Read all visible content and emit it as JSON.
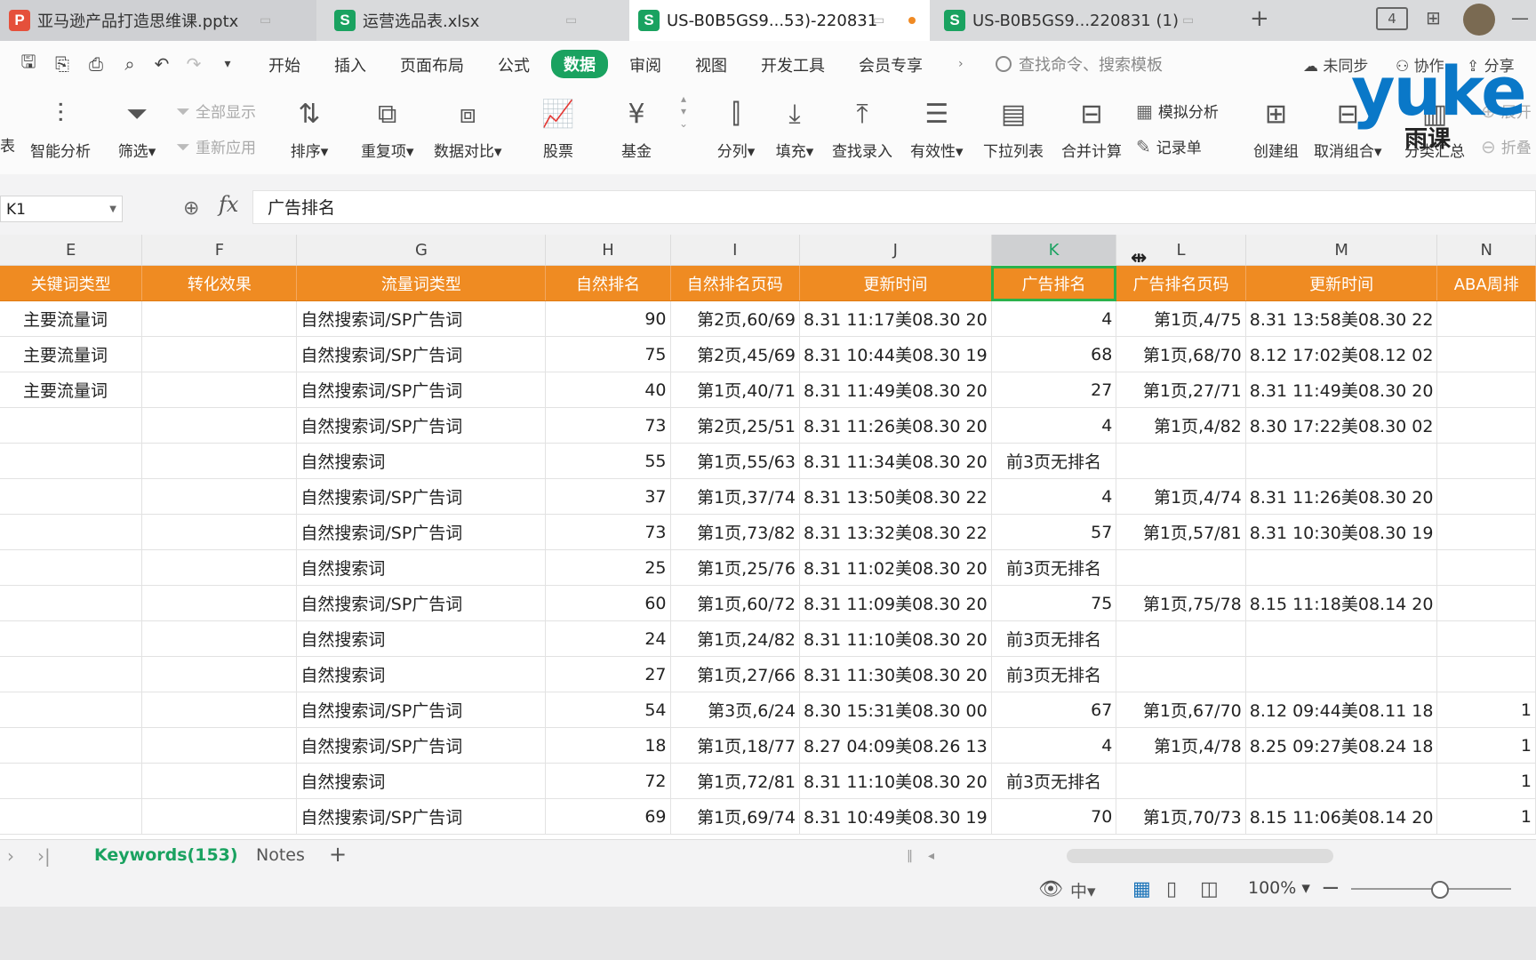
{
  "tabs": [
    {
      "name": "亚马逊产品打造思维课.pptx",
      "icon": "P",
      "color": "#e5503b"
    },
    {
      "name": "运营选品表.xlsx",
      "icon": "S",
      "color": "#1aa260"
    },
    {
      "name": "US-B0B5GS9...53)-220831",
      "icon": "S",
      "color": "#1aa260"
    },
    {
      "name": "US-B0B5GS9...220831 (1)",
      "icon": "S",
      "color": "#1aa260"
    }
  ],
  "tabbar": {
    "new_tab": "+",
    "window_count": "4"
  },
  "menu": [
    "开始",
    "插入",
    "页面布局",
    "公式",
    "数据",
    "审阅",
    "视图",
    "开发工具",
    "会员专享"
  ],
  "search_placeholder": "查找命令、搜索模板",
  "right_tools": {
    "sync": "未同步",
    "collab": "协作",
    "share": "分享"
  },
  "ribbon": {
    "cut_label": "表",
    "smart_analysis": "智能分析",
    "filter": "筛选",
    "show_all": "全部显示",
    "reapply": "重新应用",
    "sort": "排序",
    "duplicates": "重复项",
    "compare": "数据对比",
    "stocks": "股票",
    "fund": "基金",
    "split": "分列",
    "fill": "填充",
    "lookup": "查找录入",
    "validity": "有效性",
    "dropdown": "下拉列表",
    "consolidate": "合并计算",
    "whatif": "模拟分析",
    "records": "记录单",
    "group": "创建组",
    "ungroup": "取消组合",
    "subtotal": "分类汇总",
    "expand": "展开",
    "collapse": "折叠"
  },
  "formula_bar": {
    "cell": "K1",
    "fx": "fx",
    "value": "广告排名"
  },
  "columns": [
    "E",
    "F",
    "G",
    "H",
    "I",
    "J",
    "K",
    "L",
    "M",
    "N"
  ],
  "header_row": [
    "关键词类型",
    "转化效果",
    "流量词类型",
    "自然排名",
    "自然排名页码",
    "更新时间",
    "广告排名",
    "广告排名页码",
    "更新时间",
    "ABA周排"
  ],
  "rows": [
    [
      "主要流量词",
      "",
      "自然搜索词/SP广告词",
      "90",
      "第2页,60/69",
      "8.31 11:17美08.30 20",
      "4",
      "第1页,4/75",
      "8.31 13:58美08.30 22",
      ""
    ],
    [
      "主要流量词",
      "",
      "自然搜索词/SP广告词",
      "75",
      "第2页,45/69",
      "8.31 10:44美08.30 19",
      "68",
      "第1页,68/70",
      "8.12 17:02美08.12 02",
      ""
    ],
    [
      "主要流量词",
      "",
      "自然搜索词/SP广告词",
      "40",
      "第1页,40/71",
      "8.31 11:49美08.30 20",
      "27",
      "第1页,27/71",
      "8.31 11:49美08.30 20",
      ""
    ],
    [
      "",
      "",
      "自然搜索词/SP广告词",
      "73",
      "第2页,25/51",
      "8.31 11:26美08.30 20",
      "4",
      "第1页,4/82",
      "8.30 17:22美08.30 02",
      ""
    ],
    [
      "",
      "",
      "自然搜索词",
      "55",
      "第1页,55/63",
      "8.31 11:34美08.30 20",
      "前3页无排名",
      "",
      "",
      ""
    ],
    [
      "",
      "",
      "自然搜索词/SP广告词",
      "37",
      "第1页,37/74",
      "8.31 13:50美08.30 22",
      "4",
      "第1页,4/74",
      "8.31 11:26美08.30 20",
      ""
    ],
    [
      "",
      "",
      "自然搜索词/SP广告词",
      "73",
      "第1页,73/82",
      "8.31 13:32美08.30 22",
      "57",
      "第1页,57/81",
      "8.31 10:30美08.30 19",
      ""
    ],
    [
      "",
      "",
      "自然搜索词",
      "25",
      "第1页,25/76",
      "8.31 11:02美08.30 20",
      "前3页无排名",
      "",
      "",
      ""
    ],
    [
      "",
      "",
      "自然搜索词/SP广告词",
      "60",
      "第1页,60/72",
      "8.31 11:09美08.30 20",
      "75",
      "第1页,75/78",
      "8.15 11:18美08.14 20",
      ""
    ],
    [
      "",
      "",
      "自然搜索词",
      "24",
      "第1页,24/82",
      "8.31 11:10美08.30 20",
      "前3页无排名",
      "",
      "",
      ""
    ],
    [
      "",
      "",
      "自然搜索词",
      "27",
      "第1页,27/66",
      "8.31 11:30美08.30 20",
      "前3页无排名",
      "",
      "",
      ""
    ],
    [
      "",
      "",
      "自然搜索词/SP广告词",
      "54",
      "第3页,6/24",
      "8.30 15:31美08.30 00",
      "67",
      "第1页,67/70",
      "8.12 09:44美08.11 18",
      "1"
    ],
    [
      "",
      "",
      "自然搜索词/SP广告词",
      "18",
      "第1页,18/77",
      "8.27 04:09美08.26 13",
      "4",
      "第1页,4/78",
      "8.25 09:27美08.24 18",
      "1"
    ],
    [
      "",
      "",
      "自然搜索词",
      "72",
      "第1页,72/81",
      "8.31 11:10美08.30 20",
      "前3页无排名",
      "",
      "",
      "1"
    ],
    [
      "",
      "",
      "自然搜索词/SP广告词",
      "69",
      "第1页,69/74",
      "8.31 10:49美08.30 19",
      "70",
      "第1页,70/73",
      "8.15 11:06美08.14 20",
      "1"
    ]
  ],
  "sheets": [
    "Keywords(153)",
    "Notes"
  ],
  "add_sheet": "+",
  "status": {
    "zoom": "100%",
    "ime": "中"
  },
  "watermark": {
    "brand": "yuke",
    "sub": "雨课"
  },
  "colors": {
    "header_orange": "#ef8b22",
    "accent_green": "#1aa260",
    "selection": "#2bb24c"
  }
}
